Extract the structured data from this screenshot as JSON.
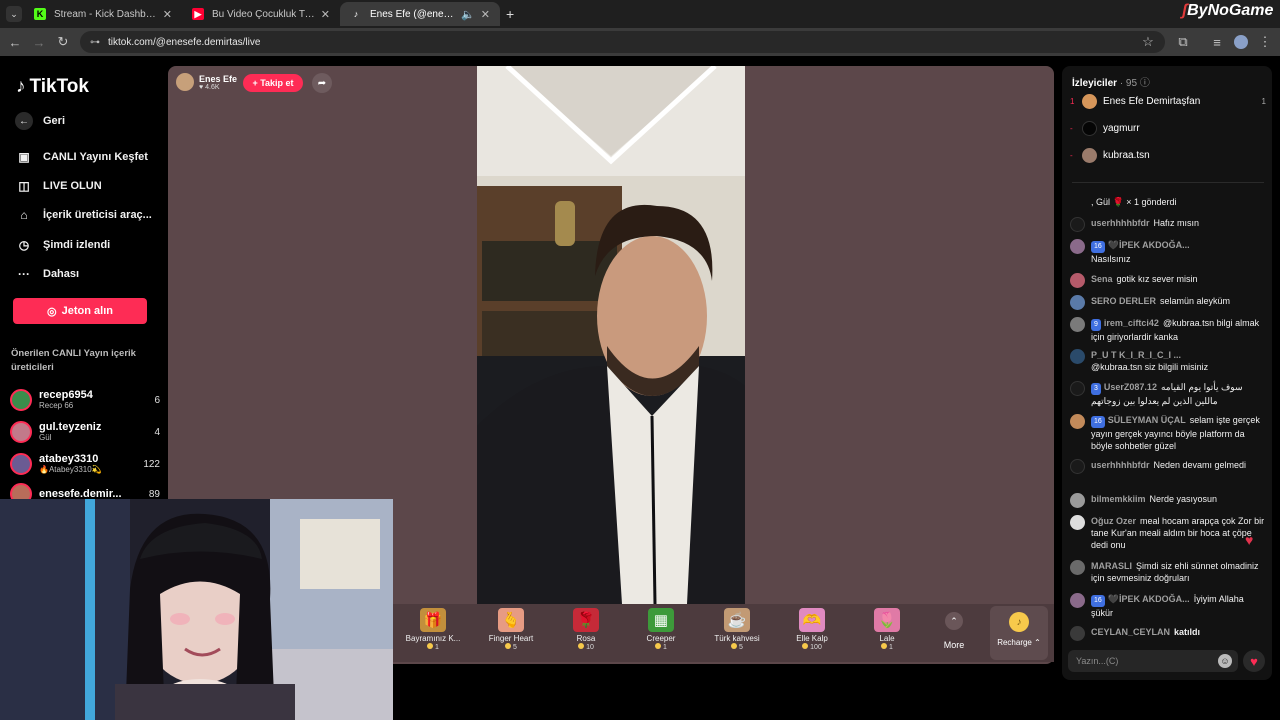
{
  "browser": {
    "tabs": [
      {
        "label": "Stream - Kick Dashboard",
        "favicon": "kick-icon",
        "color": "#53fc18"
      },
      {
        "label": "Bu Video Çocukluk Travmamdı",
        "favicon": "youtube-icon",
        "color": "#ff0033"
      },
      {
        "label": "Enes Efe (@enesefe.demirtas",
        "favicon": "tiktok-icon",
        "color": "#ffffff"
      }
    ],
    "url": "tiktok.com/@enesefe.demirtas/live",
    "brand_watermark": "ByNoGame"
  },
  "sidebar": {
    "logo": "TikTok",
    "back_label": "Geri",
    "items": [
      {
        "label": "CANLI Yayını Keşfet",
        "icon": "live-tv-icon"
      },
      {
        "label": "LIVE OLUN",
        "icon": "video-camera-icon"
      },
      {
        "label": "İçerik üreticisi araç...",
        "icon": "creator-tools-icon"
      },
      {
        "label": "Şimdi izlendi",
        "icon": "history-icon"
      },
      {
        "label": "Dahası",
        "icon": "more-dots-icon"
      }
    ],
    "jeton_label": "Jeton alın",
    "recommended_heading": "Önerilen CANLI Yayın içerik üreticileri",
    "creators": [
      {
        "name": "recep6954",
        "sub": "Recep 66",
        "count": "6",
        "color": "#3a8d4b"
      },
      {
        "name": "gul.teyzeniz",
        "sub": "Gül",
        "count": "4",
        "color": "#c27a8a"
      },
      {
        "name": "atabey3310",
        "sub": "🔥Atabey3310💫",
        "count": "122",
        "color": "#6b5b93"
      },
      {
        "name": "enesefe.demir...",
        "sub": "",
        "count": "89",
        "color": "#b86d5a"
      }
    ]
  },
  "player": {
    "host_name": "Enes Efe",
    "host_likes": "4.6K",
    "follow_label": "+ Takip et",
    "gifts": [
      {
        "name": "Bayramınız K...",
        "price": "1",
        "icon": "🎁",
        "color": "#c28f3c"
      },
      {
        "name": "Finger Heart",
        "price": "5",
        "icon": "🫰",
        "color": "#e79b83"
      },
      {
        "name": "Rosa",
        "price": "10",
        "icon": "🌹",
        "color": "#c62a38"
      },
      {
        "name": "Creeper",
        "price": "1",
        "icon": "▦",
        "color": "#3d9a3a"
      },
      {
        "name": "Türk kahvesi",
        "price": "5",
        "icon": "☕",
        "color": "#c29a74"
      },
      {
        "name": "Elle Kalp",
        "price": "100",
        "icon": "🫶",
        "color": "#e08ac1"
      },
      {
        "name": "Lale",
        "price": "1",
        "icon": "🌷",
        "color": "#e07aa6"
      }
    ],
    "more_label": "More",
    "recharge_label": "Recharge"
  },
  "chat": {
    "viewers_label": "İzleyiciler",
    "viewers_count": "· 95",
    "top_viewers": [
      {
        "rank": "1",
        "name": "Enes Efe Demirtaşfan",
        "score": "1",
        "color": "#d6965a"
      },
      {
        "rank": "-",
        "name": "yagmurr",
        "score": "",
        "color": "#111111"
      },
      {
        "rank": "-",
        "name": "kubraa.tsn",
        "score": "",
        "color": "#9a7b6b"
      }
    ],
    "messages": [
      {
        "user": "",
        "badge": "",
        "text": ", Gül 🌹 × 1 gönderdi",
        "color": "#333333"
      },
      {
        "user": "userhhhhbfdr",
        "badge": "",
        "text": "Hafız mısın",
        "color": "#1a1a1a"
      },
      {
        "user": "🖤İPEK AKDOĞA...",
        "badge": "16",
        "text": "Nasılsınız",
        "color": "#8a6a8a"
      },
      {
        "user": "Sena",
        "badge": "",
        "text": "gotik kız sever misin",
        "color": "#b55a6a"
      },
      {
        "user": "SERO DERLER",
        "badge": "",
        "text": "selamün aleyküm",
        "color": "#5a7aa8"
      },
      {
        "user": "irem_ciftci42",
        "badge": "9",
        "text": "@kubraa.tsn bilgi almak için giriyorlardir kanka",
        "color": "#7a7a7a"
      },
      {
        "user": "P_U T K_I_R_I_C_I ...",
        "badge": "",
        "text": "@kubraa.tsn siz bilgili misiniz",
        "color": "#2a4a6a"
      },
      {
        "user": "UserZ087.12",
        "badge": "3",
        "text": "سوف يأتوا يوم القيامه ماللين الذين لم يعدلوا بين زوجاتهم",
        "color": "#1a1a1a"
      },
      {
        "user": "SÜLEYMAN ÜÇAL",
        "badge": "16",
        "text": "selam işte gerçek yayın gerçek yayıncı böyle platform da böyle sohbetler güzel",
        "color": "#c28a5a"
      },
      {
        "user": "userhhhhbfdr",
        "badge": "",
        "text": "Neden devamı gelmedi",
        "color": "#1a1a1a"
      },
      {
        "user": "bilmemkkiim",
        "badge": "",
        "text": "Nerde yasıyosun",
        "color": "#9a9a9a"
      },
      {
        "user": "Oğuz Ozer",
        "badge": "",
        "text": "meal hocam arapça çok Zor bir tane Kur'an meali aldım bir hoca at çöpe dedi onu",
        "color": "#dddddd"
      },
      {
        "user": "MARASLI",
        "badge": "",
        "text": "Şimdi siz ehli sünnet olmadiniz için sevmesiniz doğruları",
        "color": "#6a6a6a"
      },
      {
        "user": "🖤İPEK AKDOĞA...",
        "badge": "16",
        "text": "İyiyim Allaha şükür",
        "color": "#8a6a8a"
      },
      {
        "user": "CEYLAN_CEYLAN",
        "badge": "",
        "text": "katıldı",
        "color": "#3a3a3a"
      }
    ],
    "input_placeholder": "Yazın...(C)"
  }
}
